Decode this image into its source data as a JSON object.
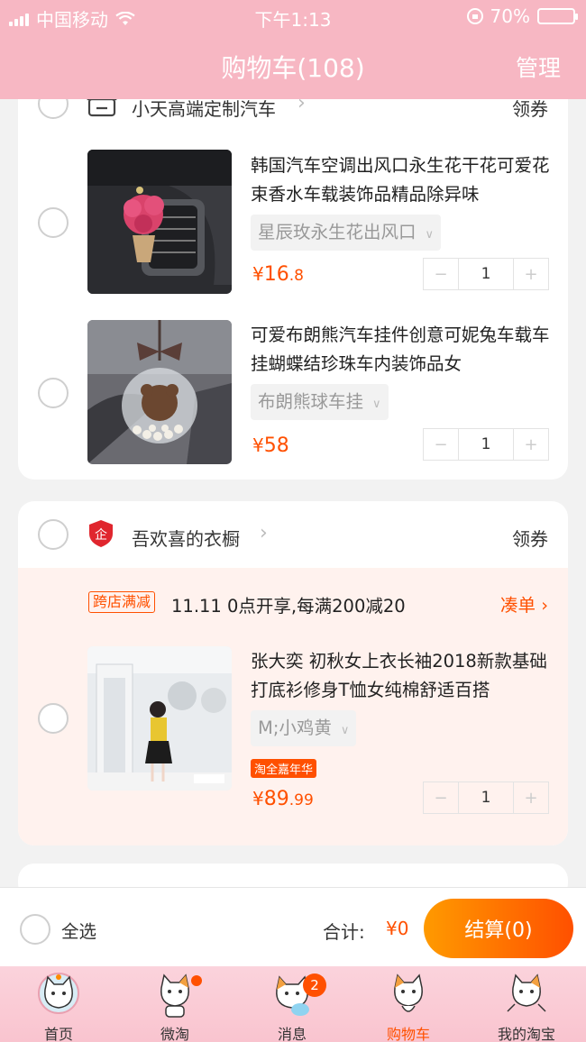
{
  "status_bar": {
    "carrier": "中国移动",
    "time": "下午1:13",
    "battery": "70%",
    "battery_level": 0.7
  },
  "header": {
    "title": "购物车(108)",
    "manage": "管理"
  },
  "stores": [
    {
      "name": "小天高端定制汽车",
      "coupon": "领券",
      "items": [
        {
          "title": "韩国汽车空调出风口永生花干花可爱花束香水车载装饰品精品除异味",
          "sku": "星辰玫永生花出风口",
          "price_currency": "¥",
          "price_int": "16",
          "price_dec": ".8",
          "qty": "1",
          "minus": "−",
          "plus": "+"
        },
        {
          "title": "可爱布朗熊汽车挂件创意可妮兔车载车挂蝴蝶结珍珠车内装饰品女",
          "sku": "布朗熊球车挂",
          "price_currency": "¥",
          "price_int": "58",
          "price_dec": "",
          "qty": "1",
          "minus": "−",
          "plus": "+"
        }
      ]
    },
    {
      "name": "吾欢喜的衣橱",
      "coupon": "领券",
      "promo": {
        "tag": "跨店满减",
        "text": "11.11 0点开享,每满200减20",
        "more": "凑单 ›"
      },
      "items": [
        {
          "title": "张大奕 初秋女上衣长袖2018新款基础打底衫修身T恤女纯棉舒适百搭",
          "sku": "M;小鸡黄",
          "festival": "淘全嘉年华",
          "price_currency": "¥",
          "price_int": "89",
          "price_dec": ".99",
          "qty": "1",
          "minus": "−",
          "plus": "+"
        }
      ]
    }
  ],
  "checkout": {
    "select_all": "全选",
    "total_label": "合计:",
    "total_value": "¥0",
    "button": "结算(0)"
  },
  "tabbar": {
    "tabs": [
      {
        "label": "首页"
      },
      {
        "label": "微淘"
      },
      {
        "label": "消息",
        "badge": "2"
      },
      {
        "label": "购物车"
      },
      {
        "label": "我的淘宝"
      }
    ]
  },
  "colors": {
    "header_pink": "#f7b7c3",
    "accent_orange": "#ff5000",
    "promo_bg": "#fff2ee"
  }
}
